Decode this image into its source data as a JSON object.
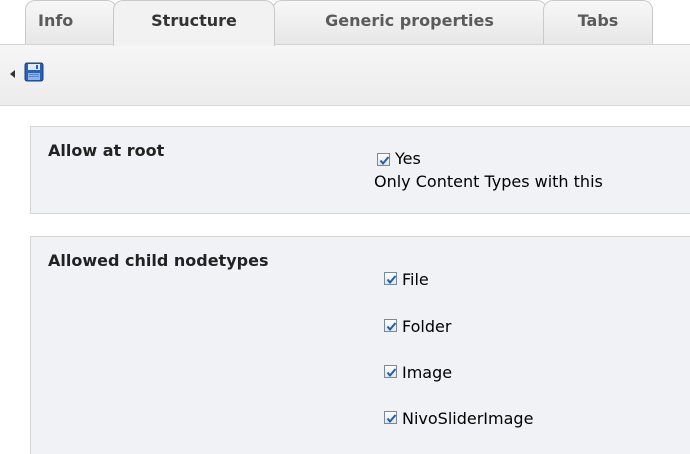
{
  "tabs": [
    {
      "label": "Info"
    },
    {
      "label": "Structure",
      "active": true
    },
    {
      "label": "Generic properties"
    },
    {
      "label": "Tabs"
    }
  ],
  "toolbar": {
    "back_icon": "triangle-left-icon",
    "save_icon": "floppy-disk-icon"
  },
  "allow_at_root": {
    "label": "Allow at root",
    "option_label": "Yes",
    "checked": true,
    "hint": "Only Content Types with this"
  },
  "allowed_children": {
    "label": "Allowed child nodetypes",
    "items": [
      {
        "label": "File",
        "checked": true
      },
      {
        "label": "Folder",
        "checked": true
      },
      {
        "label": "Image",
        "checked": true
      },
      {
        "label": "NivoSliderImage",
        "checked": true
      }
    ]
  },
  "colors": {
    "panel_bg": "#f1f2f5",
    "tab_bg": "#f2f2f2",
    "checkbox_border": "#7a8a99",
    "check_mark": "#1f5fa6"
  }
}
